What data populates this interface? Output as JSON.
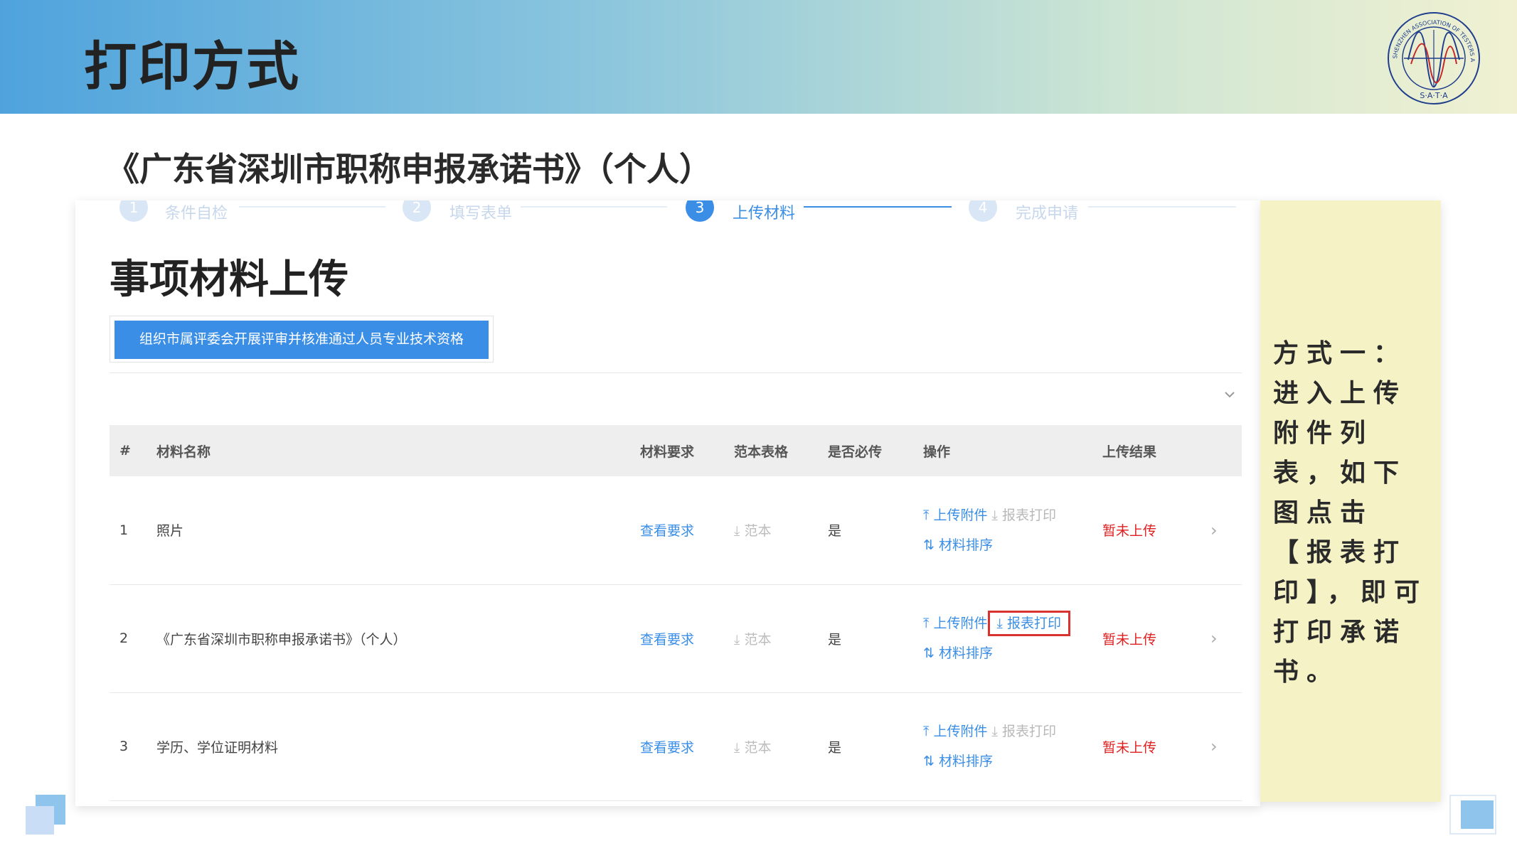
{
  "header": {
    "title": "打印方式"
  },
  "logo": {
    "ring_text": "SHENZHEN ASSOCIATION OF TESTERS AND ANALYSIS",
    "abbr": "S·A·T·A",
    "colors": [
      "#1f3e8c",
      "#c62828"
    ]
  },
  "subtitle": "《广东省深圳市职称申报承诺书》（个人）",
  "steps": [
    {
      "number": "1",
      "label": "条件自检",
      "active": false
    },
    {
      "number": "2",
      "label": "填写表单",
      "active": false
    },
    {
      "number": "3",
      "label": "上传材料",
      "active": true
    },
    {
      "number": "4",
      "label": "完成申请",
      "active": false
    }
  ],
  "section_title": "事项材料上传",
  "tab_label": "组织市属评委会开展评审并核准通过人员专业技术资格",
  "table": {
    "headers": [
      "#",
      "材料名称",
      "材料要求",
      "范本表格",
      "是否必传",
      "操作",
      "上传结果"
    ],
    "rows": [
      {
        "index": "1",
        "name": "照片",
        "requirement": "查看要求",
        "template": "范本",
        "required": "是",
        "op_upload": "上传附件",
        "op_print": "报表打印",
        "op_sort": "材料排序",
        "result": "暂未上传"
      },
      {
        "index": "2",
        "name": "《广东省深圳市职称申报承诺书》（个人）",
        "requirement": "查看要求",
        "template": "范本",
        "required": "是",
        "op_upload": "上传附件",
        "op_print": "报表打印",
        "op_sort": "材料排序",
        "result": "暂未上传"
      },
      {
        "index": "3",
        "name": "学历、学位证明材料",
        "requirement": "查看要求",
        "template": "范本",
        "required": "是",
        "op_upload": "上传附件",
        "op_print": "报表打印",
        "op_sort": "材料排序",
        "result": "暂未上传"
      }
    ]
  },
  "note": "方式一：进入上传附件列表，如下图点击【报表打印】，即可打印承诺书。",
  "colors": {
    "accent": "#3a8ee6",
    "highlight_box": "#d9322f",
    "status_red": "#e02020",
    "note_bg": "#f5f3c6"
  },
  "icons": {
    "upload": "upload-icon",
    "download": "download-icon",
    "sort": "sort-icon",
    "chevron": "chevron-right-icon"
  }
}
